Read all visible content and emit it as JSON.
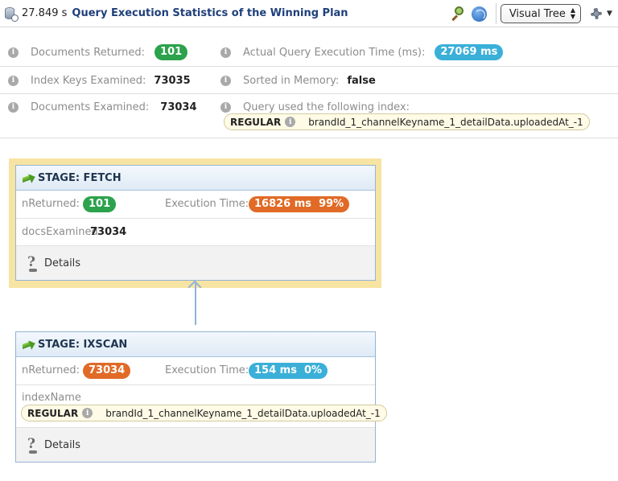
{
  "header": {
    "elapsed": "27.849 s",
    "title": "Query Execution Statistics of the Winning Plan",
    "view_select": "Visual Tree"
  },
  "summary": {
    "docs_returned_label": "Documents Returned:",
    "docs_returned_value": "101",
    "exec_time_label": "Actual Query Execution Time (ms):",
    "exec_time_value": "27069 ms",
    "keys_examined_label": "Index Keys Examined:",
    "keys_examined_value": "73035",
    "sorted_label": "Sorted in Memory:",
    "sorted_value": "false",
    "docs_examined_label": "Documents Examined:",
    "docs_examined_value": "73034",
    "index_used_label": "Query used the following index:",
    "index_kind": "REGULAR",
    "index_name": "brandId_1_channelKeyname_1_detailData.uploadedAt_-1"
  },
  "stages": {
    "fetch": {
      "title": "STAGE: FETCH",
      "nreturned_label": "nReturned:",
      "nreturned_value": "101",
      "exec_label": "Execution Time:",
      "exec_value": "16826 ms  99%",
      "docs_examined_label": "docsExamined",
      "docs_examined_value": "73034",
      "details_label": "Details"
    },
    "ixscan": {
      "title": "STAGE: IXSCAN",
      "nreturned_label": "nReturned:",
      "nreturned_value": "73034",
      "exec_label": "Execution Time:",
      "exec_value": "154 ms  0%",
      "index_name_label": "indexName",
      "index_kind": "REGULAR",
      "index_name": "brandId_1_channelKeyname_1_detailData.uploadedAt_-1",
      "details_label": "Details"
    }
  },
  "colors": {
    "title_blue": "#1f3f7a",
    "pill_green": "#2ca24c",
    "pill_teal": "#3aafd8",
    "pill_orange": "#e06a26",
    "highlight": "#f7e4a2"
  }
}
